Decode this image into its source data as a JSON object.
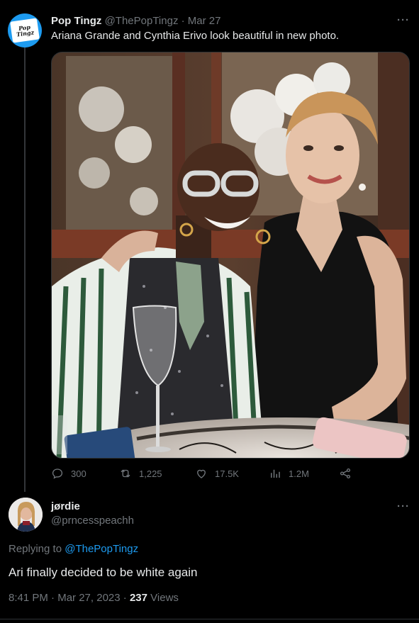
{
  "quoted_tweet": {
    "avatar_text_top": "Pop",
    "avatar_text_bottom": "Tingz",
    "display_name": "Pop Tingz",
    "handle": "@ThePopTingz",
    "separator": "·",
    "date": "Mar 27",
    "text": "Ariana Grande and Cynthia Erivo look beautiful in new photo.",
    "more_icon": "ellipsis-icon",
    "actions": {
      "replies": "300",
      "retweets": "1,225",
      "likes": "17.5K",
      "views": "1.2M"
    }
  },
  "reply": {
    "display_name": "jørdie",
    "handle": "@prncesspeachh",
    "replying_prefix": "Replying to",
    "replying_to": "@ThePopTingz",
    "text": "Ari finally decided to be white again",
    "time": "8:41 PM",
    "separator": "·",
    "date": "Mar 27, 2023",
    "separator2": "·",
    "view_count": "237",
    "views_label": "Views",
    "more_icon": "ellipsis-icon"
  },
  "colors": {
    "background": "#000000",
    "text_primary": "#e7e9ea",
    "text_secondary": "#71767b",
    "accent": "#1d9bf0",
    "divider": "#2f3336"
  }
}
